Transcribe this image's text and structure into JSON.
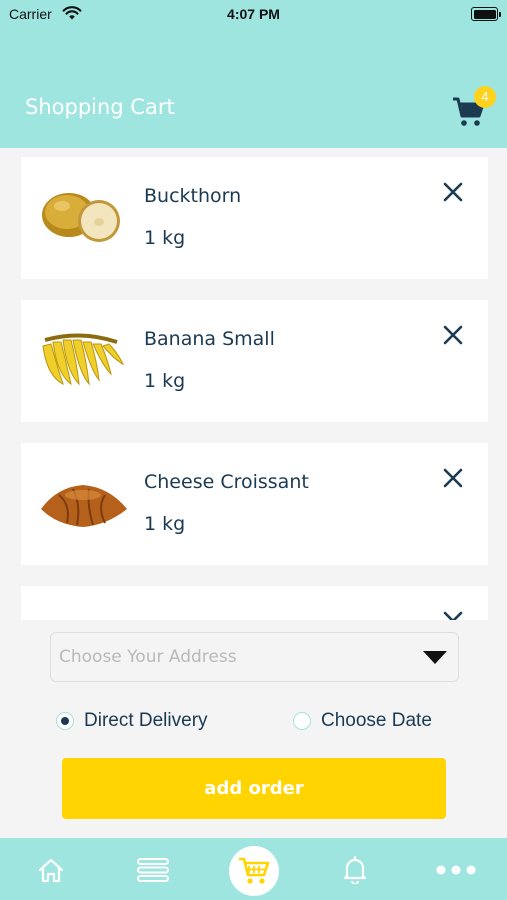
{
  "status_bar": {
    "carrier": "Carrier",
    "time": "4:07 PM"
  },
  "header": {
    "title": "Shopping Cart",
    "cart_count": "4"
  },
  "cart_items": [
    {
      "name": "Buckthorn",
      "quantity": "1 kg",
      "image": "buckthorn-image"
    },
    {
      "name": "Banana Small",
      "quantity": "1 kg",
      "image": "banana-image"
    },
    {
      "name": "Cheese Croissant",
      "quantity": "1 kg",
      "image": "croissant-image"
    },
    {
      "name": "",
      "quantity": "",
      "image": "bottle-image"
    }
  ],
  "address": {
    "placeholder": "Choose Your Address"
  },
  "delivery_options": [
    {
      "label": "Direct Delivery",
      "selected": true
    },
    {
      "label": "Choose Date",
      "selected": false
    }
  ],
  "actions": {
    "add_order": "add order"
  },
  "tab_bar": {
    "items": [
      "home-icon",
      "menu-icon",
      "cart-icon",
      "bell-icon",
      "more-icon"
    ]
  },
  "colors": {
    "accent": "#9fe5df",
    "button": "#ffd400",
    "badge": "#ffd21c",
    "text": "#1b3a52"
  }
}
